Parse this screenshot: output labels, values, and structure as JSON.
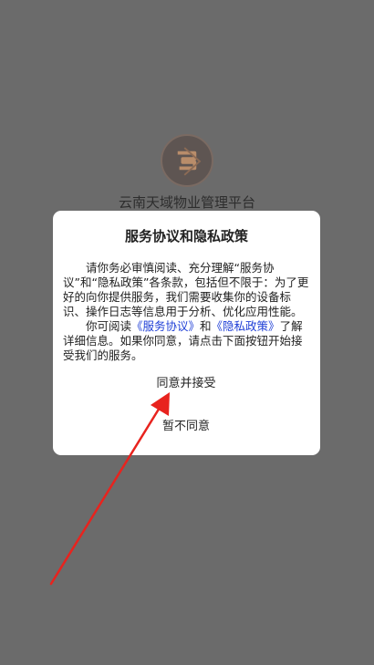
{
  "app": {
    "name": "云南天域物业管理平台"
  },
  "dialog": {
    "title": "服务协议和隐私政策",
    "paragraph1": "请你务必审慎阅读、充分理解“服务协议”和“隐私政策”各条款，包括但不限于：为了更好的向你提供服务，我们需要收集你的设备标识、操作日志等信息用于分析、优化应用性能。",
    "paragraph2_prefix": "你可阅读",
    "service_link": "《服务协议》",
    "paragraph2_and": "和",
    "privacy_link": "《隐私政策》",
    "paragraph2_suffix": "了解详细信息。如果你同意，请点击下面按钮开始接受我们的服务。",
    "accept_label": "同意并接受",
    "decline_label": "暂不同意"
  },
  "colors": {
    "overlay": "#6b6b6b",
    "link": "#1f3fd6",
    "arrow": "#e8231e"
  }
}
